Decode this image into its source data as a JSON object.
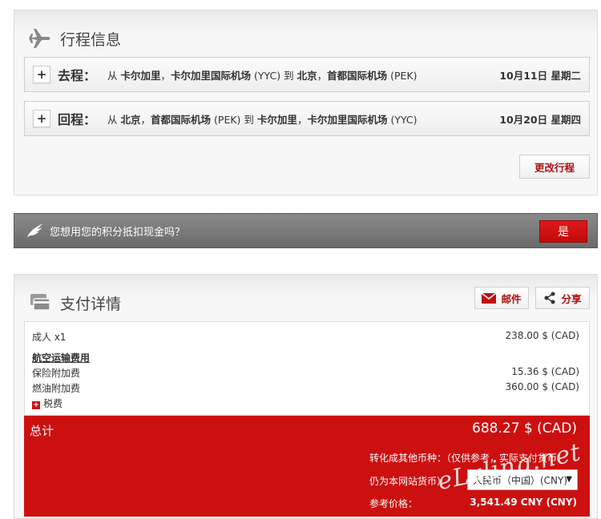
{
  "itinerary": {
    "title": "行程信息",
    "legs": [
      {
        "label": "去程：",
        "from_word": "从",
        "from_city": "卡尔加里",
        "from_airport": "卡尔加里国际机场",
        "from_code": "(YYC)",
        "to_word": "到",
        "to_city": "北京",
        "to_airport": "首都国际机场",
        "to_code": "(PEK)",
        "date": "10月11日 星期二"
      },
      {
        "label": "回程：",
        "from_word": "从",
        "from_city": "北京",
        "from_airport": "首都国际机场",
        "from_code": "(PEK)",
        "to_word": "到",
        "to_city": "卡尔加里",
        "to_airport": "卡尔加里国际机场",
        "to_code": "(YYC)",
        "date": "10月20日 星期四"
      }
    ],
    "separator": "，",
    "change_label": "更改行程"
  },
  "points": {
    "question": "您想用您的积分抵扣现金吗？",
    "yes_label": "是"
  },
  "payment": {
    "title": "支付详情",
    "email_label": "邮件",
    "share_label": "分享",
    "adult_label": "成人 x1",
    "adult_value": "238.00 $ (CAD)",
    "category_label": "航空运输费用",
    "insurance_label": "保险附加费",
    "insurance_value": "15.36 $ (CAD)",
    "fuel_label": "燃油附加费",
    "fuel_value": "360.00 $ (CAD)",
    "tax_label": "税费",
    "total_label": "总计",
    "total_value": "688.27 $ (CAD)",
    "convert_line1": "转化成其他币种：（仅供参考，实际支付货币",
    "convert_line2": "仍为本网站货币）",
    "currency_selected": "人民币（中国）(CNY)",
    "reference_label": "参考价格：",
    "reference_value": "3,541.49 CNY (CNY)"
  },
  "watermark": "eLvling.net",
  "colors": {
    "accent_red": "#cc1010",
    "dark_bar": "#777777"
  }
}
